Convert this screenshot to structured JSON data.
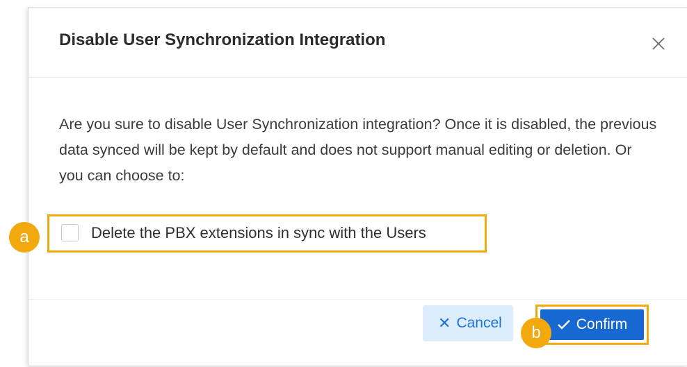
{
  "dialog": {
    "title": "Disable User Synchronization Integration",
    "message": "Are you sure to disable User Synchronization integration? Once it is disabled, the previous data synced will be kept by default and does not support manual editing or deletion. Or you can choose to:",
    "option_label": "Delete the PBX extensions in sync with the Users",
    "option_checked": false,
    "cancel_label": "Cancel",
    "confirm_label": "Confirm"
  },
  "annotations": {
    "a": "a",
    "b": "b"
  },
  "colors": {
    "accent": "#1768d0",
    "highlight": "#f2a90e",
    "cancel_bg": "#dcecfb"
  },
  "icons": [
    "close-icon",
    "x-icon",
    "check-icon"
  ]
}
